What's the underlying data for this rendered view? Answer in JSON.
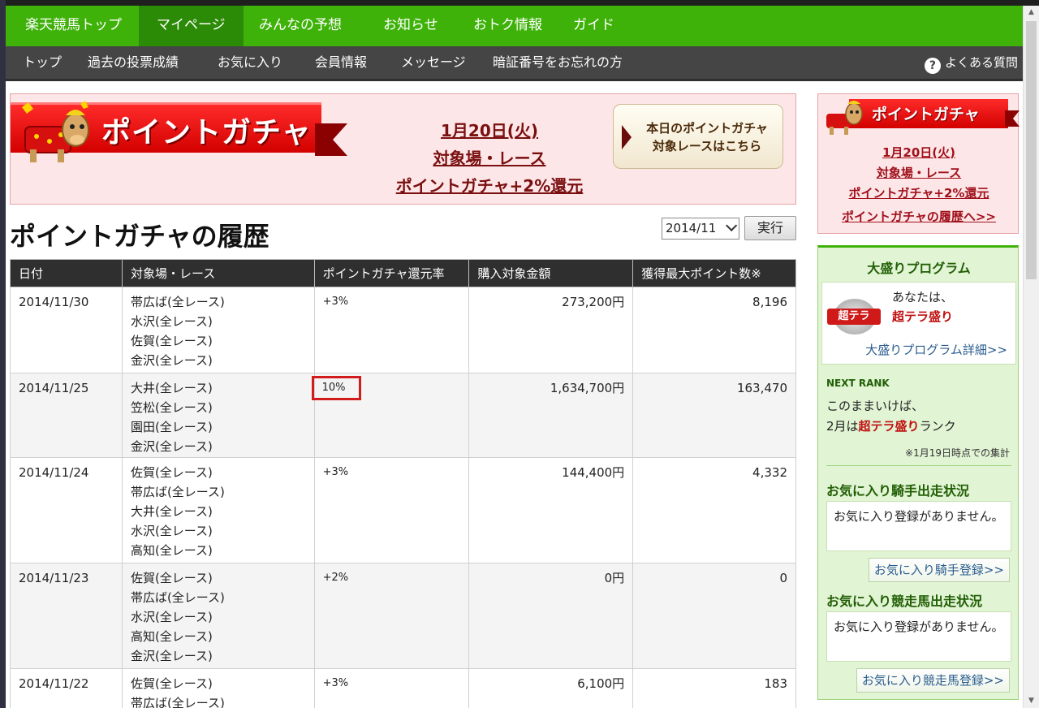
{
  "nav": {
    "main": [
      "楽天競馬トップ",
      "マイページ",
      "みんなの予想",
      "お知らせ",
      "おトク情報",
      "ガイド"
    ],
    "sub": [
      "トップ",
      "過去の投票成績",
      "お気に入り",
      "会員情報",
      "メッセージ",
      "暗証番号をお忘れの方"
    ],
    "help": "よくある質問"
  },
  "banner": {
    "title": "ポイントガチャ",
    "date": "1月20日(火)",
    "target": "対象場・レース",
    "bonus": "ポイントガチャ+2%還元",
    "button_line1": "本日のポイントガチャ",
    "button_line2": "対象レースはこちら"
  },
  "history": {
    "title": "ポイントガチャの履歴",
    "selected_month": "2014/11",
    "run_label": "実行",
    "columns": [
      "日付",
      "対象場・レース",
      "ポイントガチャ還元率",
      "購入対象金額",
      "獲得最大ポイント数※"
    ],
    "rows": [
      {
        "date": "2014/11/30",
        "venues": [
          "帯広ば(全レース)",
          "水沢(全レース)",
          "佐賀(全レース)",
          "金沢(全レース)"
        ],
        "rate": "+3%",
        "amount": "273,200円",
        "points": "8,196"
      },
      {
        "date": "2014/11/25",
        "venues": [
          "大井(全レース)",
          "笠松(全レース)",
          "園田(全レース)",
          "金沢(全レース)"
        ],
        "rate": "10%",
        "amount": "1,634,700円",
        "points": "163,470"
      },
      {
        "date": "2014/11/24",
        "venues": [
          "佐賀(全レース)",
          "帯広ば(全レース)",
          "大井(全レース)",
          "水沢(全レース)",
          "高知(全レース)"
        ],
        "rate": "+3%",
        "amount": "144,400円",
        "points": "4,332"
      },
      {
        "date": "2014/11/23",
        "venues": [
          "佐賀(全レース)",
          "帯広ば(全レース)",
          "水沢(全レース)",
          "高知(全レース)",
          "金沢(全レース)"
        ],
        "rate": "+2%",
        "amount": "0円",
        "points": "0"
      },
      {
        "date": "2014/11/22",
        "venues": [
          "佐賀(全レース)",
          "帯広ば(全レース)"
        ],
        "rate": "+3%",
        "amount": "6,100円",
        "points": "183"
      }
    ]
  },
  "sidebar": {
    "gacha": {
      "title": "ポイントガチャ",
      "date": "1月20日(火)",
      "target": "対象場・レース",
      "bonus": "ポイントガチャ+2%還元",
      "history_link": "ポイントガチャの履歴へ>>"
    },
    "omori": {
      "title": "大盛りプログラム",
      "medal_label": "超テラ",
      "you_are": "あなたは、",
      "rank": "超テラ盛り",
      "detail_link": "大盛りプログラム詳細>>",
      "next_rank_label": "NEXT RANK",
      "next_line1": "このままいけば、",
      "next_month": "2月は",
      "next_rank": "超テラ盛り",
      "next_suffix": "ランク",
      "note": "※1月19日時点での集計",
      "jockey_title": "お気に入り騎手出走状況",
      "jockey_msg": "お気に入り登録がありません。",
      "jockey_btn": "お気に入り騎手登録>>",
      "horse_title": "お気に入り競走馬出走状況",
      "horse_msg": "お気に入り登録がありません。",
      "horse_btn": "お気に入り競走馬登録>>"
    }
  },
  "colors": {
    "nav_green": "#3fb20a",
    "nav_active": "#2b8a06",
    "subnav_gray": "#454545",
    "accent_red": "#d21c1c",
    "link_dark_red": "#a0101a"
  }
}
